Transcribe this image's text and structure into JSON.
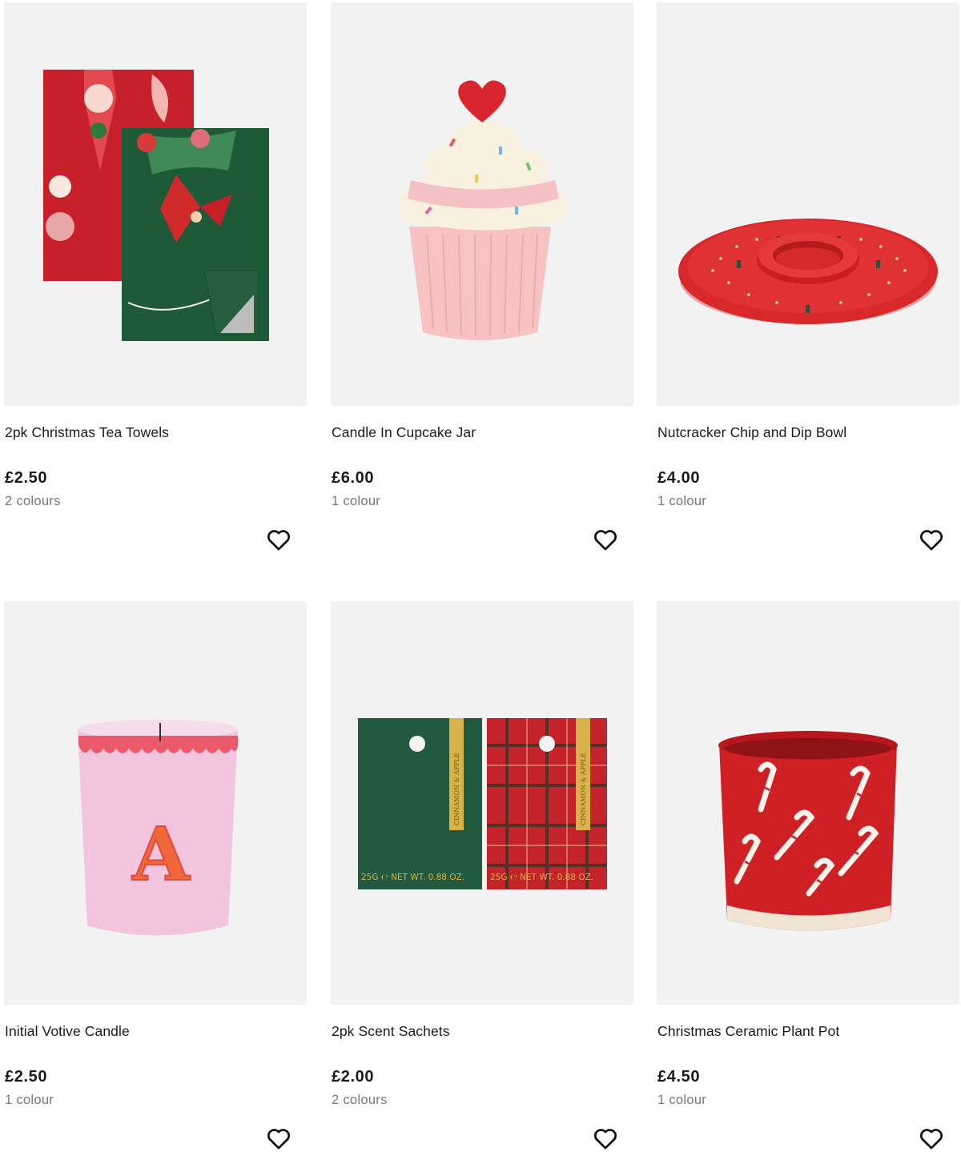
{
  "products": [
    {
      "name": "2pk Christmas Tea Towels",
      "price": "£2.50",
      "colours": "2 colours"
    },
    {
      "name": "Candle In Cupcake Jar",
      "price": "£6.00",
      "colours": "1 colour"
    },
    {
      "name": "Nutcracker Chip and Dip Bowl",
      "price": "£4.00",
      "colours": "1 colour"
    },
    {
      "name": "Initial Votive Candle",
      "price": "£2.50",
      "colours": "1 colour"
    },
    {
      "name": "2pk Scent Sachets",
      "price": "£2.00",
      "colours": "2 colours"
    },
    {
      "name": "Christmas Ceramic Plant Pot",
      "price": "£4.50",
      "colours": "1 colour"
    }
  ],
  "image_text": {
    "candle_initial": "A",
    "sachet_weight": "25G ℮ NET WT. 0.88 OZ.",
    "sachet_scent": "CINNAMON & APPLE"
  },
  "icons": {
    "wishlist": "heart-outline-icon"
  },
  "colors": {
    "tile_bg": "#f2f2f2",
    "price": "#1a1a1a",
    "muted": "#777777"
  }
}
